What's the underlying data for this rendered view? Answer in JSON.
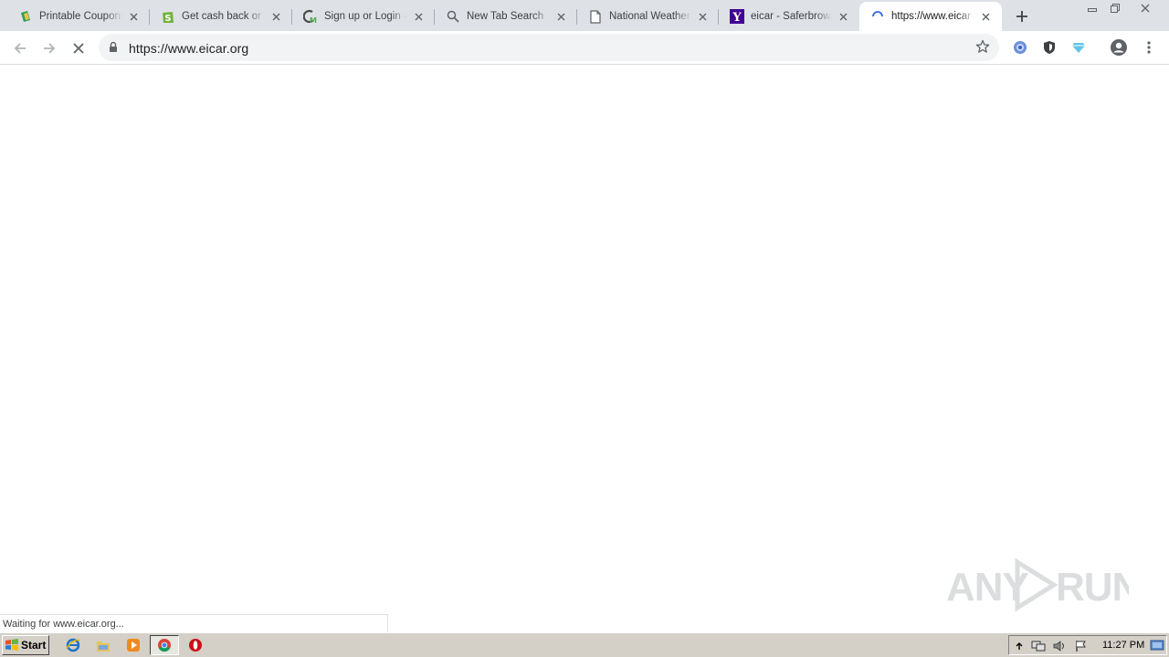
{
  "browser": {
    "tabs": [
      {
        "title": "Printable Coupons,",
        "favicon": "coupons-icon",
        "active": false
      },
      {
        "title": "Get cash back or sa",
        "favicon": "shopping-bag-icon",
        "active": false
      },
      {
        "title": "Sign up or Login - F",
        "favicon": "cm-logo-icon",
        "active": false
      },
      {
        "title": "New Tab Search",
        "favicon": "search-icon",
        "active": false
      },
      {
        "title": "National Weather A",
        "favicon": "document-icon",
        "active": false
      },
      {
        "title": "eicar - Saferbrowse",
        "favicon": "yahoo-icon",
        "active": false
      },
      {
        "title": "https://www.eicar",
        "favicon": "loading-spinner-icon",
        "active": true
      }
    ],
    "omnibox": {
      "url": "https://www.eicar.org"
    },
    "status_text": "Waiting for www.eicar.org..."
  },
  "watermark": {
    "text": "ANY RUN"
  },
  "taskbar": {
    "start_label": "Start",
    "clock": "11:27 PM"
  },
  "colors": {
    "tabstrip": "#dee1e6",
    "omnibox": "#f1f3f4",
    "taskbar": "#d4d0c8"
  }
}
